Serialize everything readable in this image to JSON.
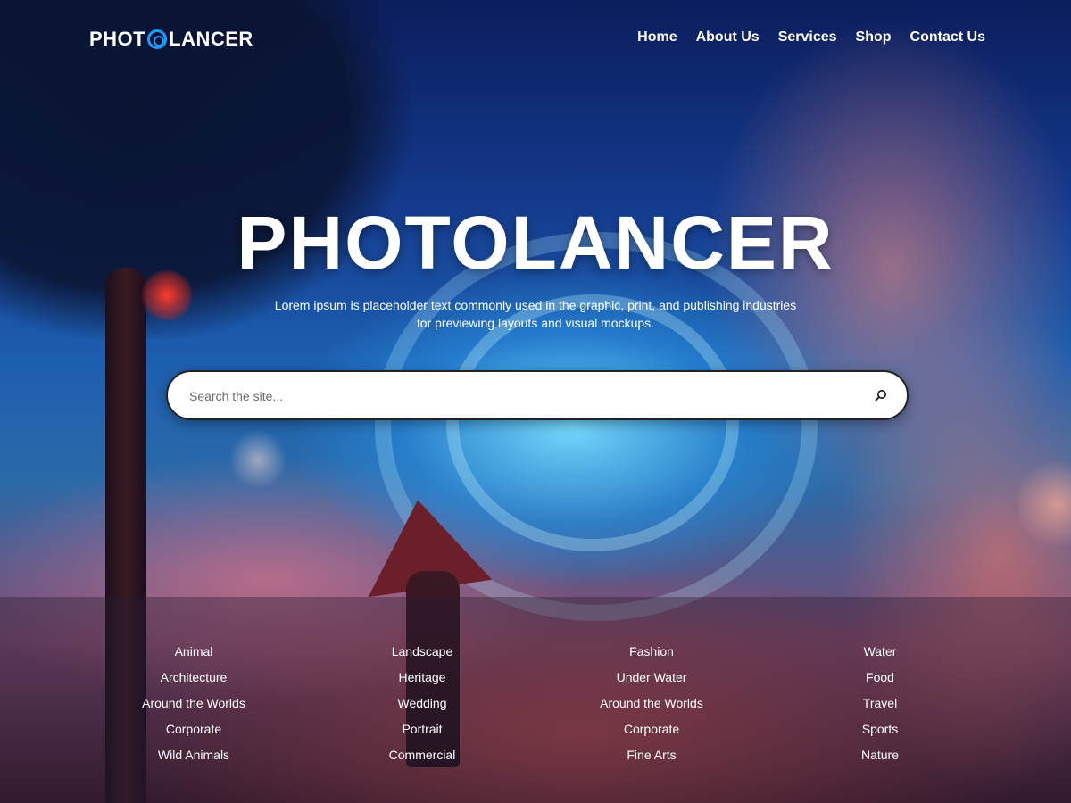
{
  "brand": {
    "logo_left": "PHOT",
    "logo_right": "LANCER",
    "accent_color": "#1e9bff",
    "logo_icon": "camera-lens-icon"
  },
  "nav": {
    "items": [
      {
        "label": "Home"
      },
      {
        "label": "About Us"
      },
      {
        "label": "Services"
      },
      {
        "label": "Shop"
      },
      {
        "label": "Contact Us"
      }
    ]
  },
  "hero": {
    "title": "PHOTOLANCER",
    "description": "Lorem ipsum is placeholder text commonly used in the graphic, print, and publishing industries for previewing layouts and visual mockups."
  },
  "search": {
    "placeholder": "Search the site...",
    "button_icon": "search-icon"
  },
  "categories": {
    "columns": [
      [
        "Animal",
        "Architecture",
        "Around the Worlds",
        "Corporate",
        "Wild Animals"
      ],
      [
        "Landscape",
        "Heritage",
        "Wedding",
        "Portrait",
        "Commercial"
      ],
      [
        "Fashion",
        "Under Water",
        "Around the Worlds",
        "Corporate",
        "Fine Arts"
      ],
      [
        "Water",
        "Food",
        "Travel",
        "Sports",
        "Nature"
      ]
    ]
  }
}
